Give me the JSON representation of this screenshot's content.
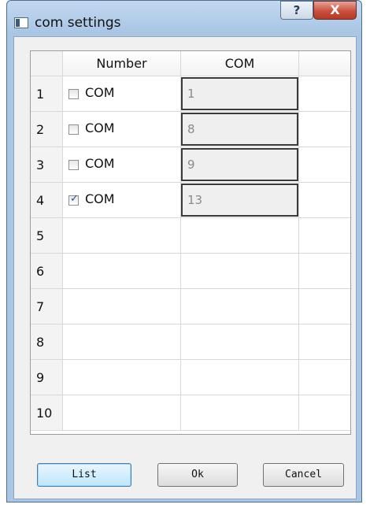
{
  "window": {
    "title": "com settings",
    "help_label": "?",
    "close_label": "X"
  },
  "table": {
    "headers": [
      "Number",
      "COM",
      ""
    ],
    "rows": [
      {
        "num": "1",
        "checked": false,
        "label": "COM",
        "com": "1"
      },
      {
        "num": "2",
        "checked": false,
        "label": "COM",
        "com": "8"
      },
      {
        "num": "3",
        "checked": false,
        "label": "COM",
        "com": "9"
      },
      {
        "num": "4",
        "checked": true,
        "label": "COM",
        "com": "13"
      },
      {
        "num": "5"
      },
      {
        "num": "6"
      },
      {
        "num": "7"
      },
      {
        "num": "8"
      },
      {
        "num": "9"
      },
      {
        "num": "10"
      }
    ]
  },
  "buttons": {
    "list": "List",
    "ok": "Ok",
    "cancel": "Cancel"
  }
}
